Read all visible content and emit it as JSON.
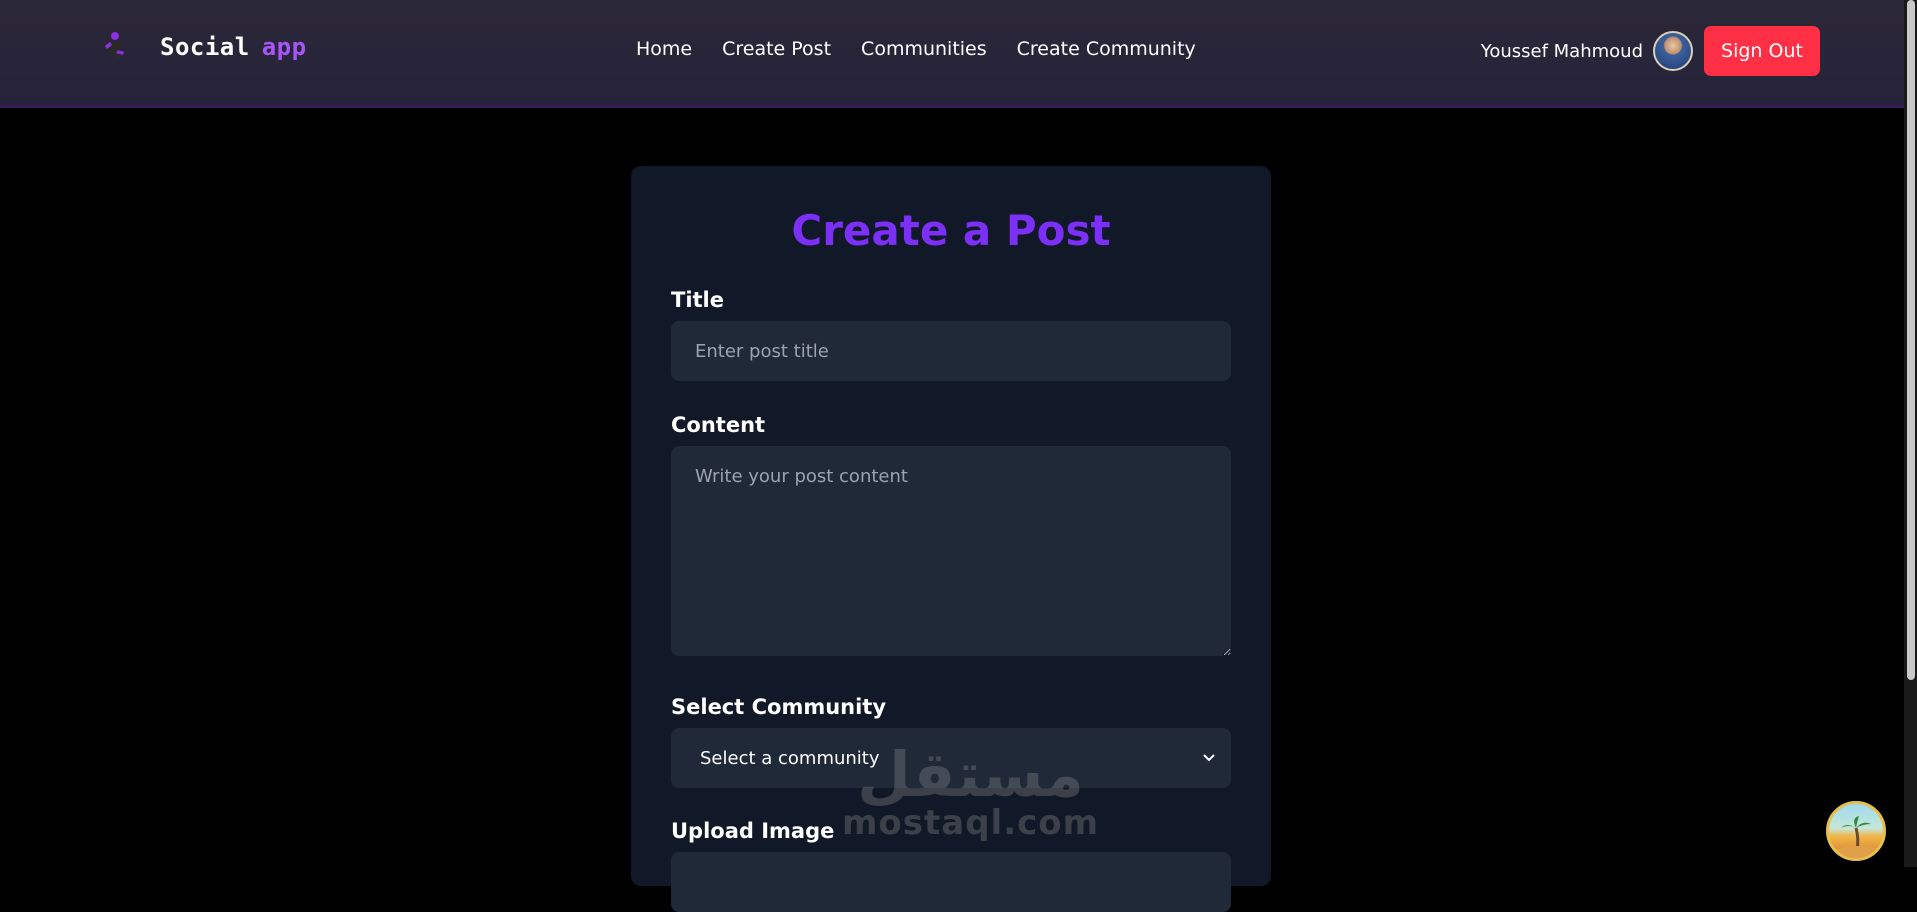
{
  "header": {
    "brand_word1": "Social",
    "brand_word2": "app",
    "nav_links": [
      "Home",
      "Create Post",
      "Communities",
      "Create Community"
    ],
    "user_name": "Youssef Mahmoud",
    "sign_out_label": "Sign Out"
  },
  "form": {
    "heading": "Create a Post",
    "title_label": "Title",
    "title_placeholder": "Enter post title",
    "title_value": "",
    "content_label": "Content",
    "content_placeholder": "Write your post content",
    "content_value": "",
    "community_label": "Select Community",
    "community_selected": "Select a community",
    "upload_label": "Upload Image"
  },
  "watermark": {
    "arabic": "مستقل",
    "latin": "mostaql.com"
  },
  "icons": {
    "logo": "runner-logo-icon",
    "select_chevron": "chevron-down-icon",
    "floating_badge": "beach-badge-icon"
  },
  "colors": {
    "accent_purple": "#7b2ff7",
    "brand_app": "#a855f7",
    "sign_out_red": "#ff2f45",
    "card_bg": "#111827",
    "input_bg": "#1f2937"
  }
}
